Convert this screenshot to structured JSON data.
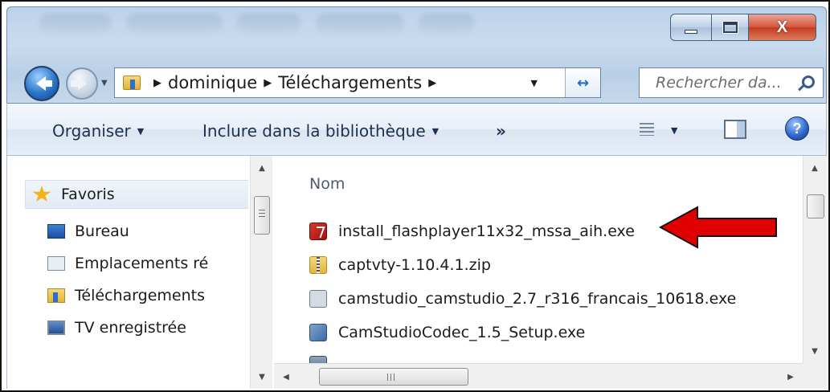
{
  "window": {
    "caption": {
      "minimize": "minimize",
      "maximize": "maximize",
      "close": "close"
    }
  },
  "nav": {
    "breadcrumbs": [
      "dominique",
      "Téléchargements"
    ],
    "search_placeholder": "Rechercher da..."
  },
  "toolbar": {
    "organize": "Organiser",
    "include_library": "Inclure dans la bibliothèque",
    "more": "»"
  },
  "sidebar": {
    "items": [
      {
        "label": "Favoris",
        "icon": "star-icon"
      },
      {
        "label": "Bureau",
        "icon": "desktop-icon"
      },
      {
        "label": "Emplacements ré",
        "icon": "recent-places-icon"
      },
      {
        "label": "Téléchargements",
        "icon": "downloads-folder-icon"
      },
      {
        "label": "TV enregistrée",
        "icon": "recorded-tv-icon"
      }
    ]
  },
  "files": {
    "column_name": "Nom",
    "items": [
      {
        "name": "install_flashplayer11x32_mssa_aih.exe",
        "icon": "flash-installer-icon"
      },
      {
        "name": "captvty-1.10.4.1.zip",
        "icon": "zip-folder-icon"
      },
      {
        "name": "camstudio_camstudio_2.7_r316_francais_10618.exe",
        "icon": "installer-icon"
      },
      {
        "name": "CamStudioCodec_1.5_Setup.exe",
        "icon": "codec-installer-icon"
      }
    ]
  },
  "annotation": {
    "arrow_color": "#e00000"
  },
  "colors": {
    "accent": "#2a6cc0",
    "close_button": "#c43a1e"
  }
}
